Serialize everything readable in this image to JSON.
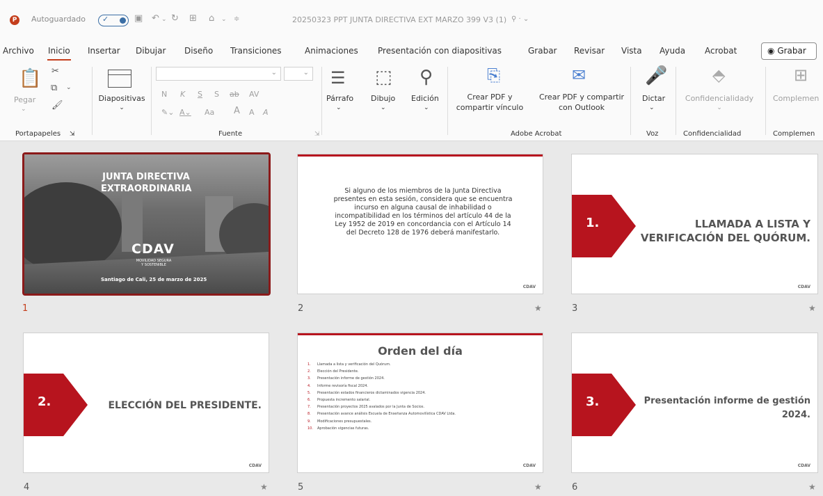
{
  "titlebar": {
    "app_logo": "P",
    "autosave_label": "Autoguardado",
    "autosave_state": "on",
    "filename": "20250323 PPT JUNTA DIRECTIVA EXT MARZO 399 V3 (1)",
    "icons": [
      "save-icon",
      "undo-icon",
      "redo-icon",
      "present-icon",
      "paint-icon",
      "customize-icon",
      "sensitivity-icon"
    ]
  },
  "menu": {
    "tabs": [
      "Archivo",
      "Inicio",
      "Insertar",
      "Dibujar",
      "Diseño",
      "Transiciones",
      "Animaciones",
      "Presentación con diapositivas",
      "Grabar",
      "Revisar",
      "Vista",
      "Ayuda",
      "Acrobat"
    ],
    "active_tab": "Inicio",
    "record_button": "Grabar"
  },
  "ribbon": {
    "portapapeles": {
      "paste": "Pegar",
      "group": "Portapapeles"
    },
    "diapositivas": {
      "label": "Diapositivas"
    },
    "fuente": {
      "group": "Fuente",
      "bold": "N",
      "italic": "K",
      "underline": "S",
      "shadow": "S",
      "strike": "ab",
      "spacing": "AV",
      "case": "Aa",
      "grow": "A",
      "shrink": "A",
      "clear": "A"
    },
    "parrafo": "Párrafo",
    "dibujo": "Dibujo",
    "edicion": "Edición",
    "acrobat": {
      "btn1": [
        "Crear PDF y",
        "compartir vínculo"
      ],
      "btn2": [
        "Crear PDF y compartir",
        "con Outlook"
      ],
      "group": "Adobe Acrobat"
    },
    "voz": {
      "btn": "Dictar",
      "group": "Voz"
    },
    "confidencialidad": {
      "btn": "Confidencialidady",
      "group": "Confidencialidad"
    },
    "complementos": {
      "btn": "Complemen",
      "group": "Complemen"
    }
  },
  "slides": [
    {
      "num": "1",
      "title": [
        "JUNTA DIRECTIVA",
        "EXTRAORDINARIA"
      ],
      "brand": "CDAV",
      "tagline": [
        "MOVILIDAD SEGURA",
        "Y SOSTENIBLE"
      ],
      "footer": "Santiago de Cali, 25 de marzo de 2025"
    },
    {
      "num": "2",
      "text": "Si alguno de los miembros de la Junta Directiva presentes en esta sesión, considera que se encuentra incurso en alguna causal de inhabilidad o incompatibilidad en los términos del artículo 44 de la Ley 1952 de 2019 en concordancia con el Artículo 14 del Decreto 128 de 1976 deberá manifestarlo.",
      "logo": "CDAV"
    },
    {
      "num": "3",
      "badge": "1.",
      "title": [
        "LLAMADA A LISTA Y",
        "VERIFICACIÓN DEL QUÓRUM."
      ],
      "logo": "CDAV"
    },
    {
      "num": "4",
      "badge": "2.",
      "title": [
        "ELECCIÓN DEL PRESIDENTE."
      ],
      "logo": "CDAV"
    },
    {
      "num": "5",
      "title": "Orden del día",
      "items": [
        "Llamada a lista y verificación del Quórum.",
        "Elección del Presidente.",
        "Presentación informe de gestión 2024.",
        "Informe revisoría fiscal 2024.",
        "Presentación estados financieros dictaminados vigencia 2024.",
        "Propuesta incremento salarial.",
        "Presentación proyectos 2025 avalados por la Junta de Socios.",
        "Presentación avance análisis Escuela de Enseñanza Automovilística CDAV Ltda.",
        "Modificaciones presupuestales.",
        "Aprobación vigencias futuras."
      ],
      "logo": "CDAV"
    },
    {
      "num": "6",
      "badge": "3.",
      "title": [
        "Presentación informe de gestión",
        "2024."
      ],
      "logo": "CDAV"
    }
  ]
}
